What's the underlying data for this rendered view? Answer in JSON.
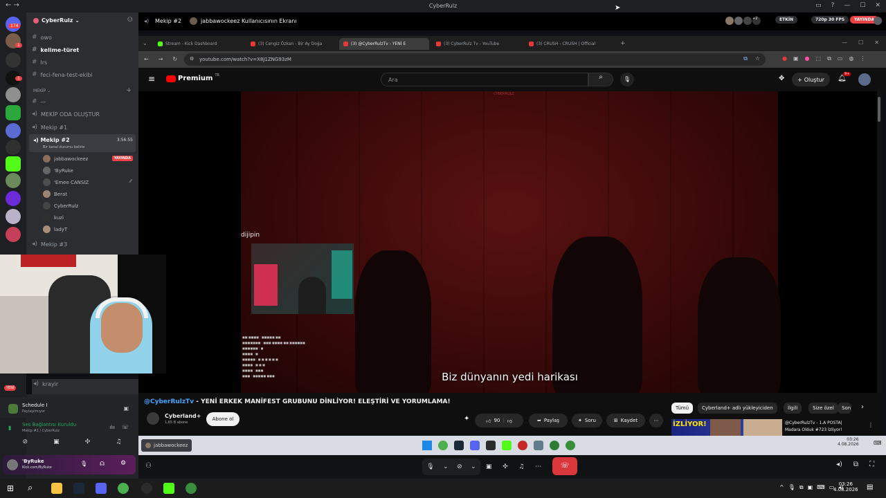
{
  "window": {
    "title": "CyberRulz"
  },
  "titlebar_nav": "← →",
  "rail_badges": {
    "top": "174",
    "notif1": "1",
    "notif2": "1"
  },
  "server": {
    "name": "CyberRulz ⌄"
  },
  "channels_top": [
    "owo",
    "kelime-türet",
    "lrs",
    "feci-fena-test-ekibi"
  ],
  "category": "MEKİP ⌄",
  "channels_mekip": [
    "—",
    "MEKİP ODA OLUŞTUR",
    "Mekip #1"
  ],
  "active_channel": {
    "name": "Mekip #2",
    "time": "3:56:55",
    "status": "Bir kanal durumu belirle"
  },
  "voice_users": [
    {
      "name": "jabbawockeez",
      "live": "YAYINDA"
    },
    {
      "name": "'ByRuke"
    },
    {
      "name": "'Emee CANSIZ"
    },
    {
      "name": "Berat"
    },
    {
      "name": "CyberRulz"
    },
    {
      "name": "kuzi"
    },
    {
      "name": "ladyT"
    }
  ],
  "channel_after": "Mekip #3",
  "channel_krayir": "krayir",
  "new_badge": "YENİ",
  "activity": {
    "title": "Schedule I",
    "sub": "Paylaşılmıyor"
  },
  "voice_conn": {
    "title": "Ses Bağlantısı Kuruldu",
    "sub": "Mekip #2 / CyberRulz"
  },
  "me": {
    "name": "'ByRuke",
    "sub": "Kick.com/ByRuke"
  },
  "stream_header": {
    "channel": "Mekip #2",
    "title": "jabbawockeez Kullanıcısının Ekranı",
    "more": "+2",
    "etkin": "ETKİN",
    "quality": "720p 30 FPS",
    "live": "YAYINDA"
  },
  "browser_tabs": [
    {
      "label": "Stream - Kick Dashboard",
      "color": "#53fc18"
    },
    {
      "label": "(3) Cengiz Özkan - Bir Ay Doğa",
      "color": "#e53935"
    },
    {
      "label": "(3) @CyberRulzTv - YENİ E",
      "color": "#e53935"
    },
    {
      "label": "(3) CyberRulz Tv - YouTube",
      "color": "#e53935"
    },
    {
      "label": "(3) CRUSH - CRUSH | Official",
      "color": "#e53935"
    }
  ],
  "url": "youtube.com/watch?v=X8J1ZNG93zM",
  "youtube": {
    "logo": "Premium",
    "tr": "TR",
    "search_placeholder": "Ara",
    "create": "Oluştur",
    "notif": "9+"
  },
  "video": {
    "watermark": "dijipin",
    "subtitle": "Biz dünyanın yedi harikası",
    "top_mark": "CYBERRULZ"
  },
  "video_title": {
    "handle": "@CyberRulzTv",
    "text": " - YENİ ERKEK MANİFEST GRUBUNU DİNLİYOR! ELEŞTİRİ VE YORUMLAMA!"
  },
  "channel_info": {
    "name": "Cyberland+",
    "subs": "1,65 B abone",
    "subscribe": "Abone ol"
  },
  "actions": {
    "likes": "90",
    "share": "Paylaş",
    "ask": "Soru",
    "save": "Kaydet"
  },
  "chips": [
    "Tümü",
    "Cyberland+ adlı yükleyiciden",
    "İlgili",
    "Size özel",
    "Son"
  ],
  "rec": {
    "title": "@CyberRulzTv - 1.A POSTA|",
    "sub": "Madara Olduk #723 İzliyor!",
    "thumb": "İZLİYOR!"
  },
  "inner_taskbar": {
    "time": "03:26",
    "date": "4.08.2026",
    "window_label": "jabbawockeez"
  },
  "taskbar": {
    "time": "03:26",
    "date": "4.08.2026"
  },
  "colors": {
    "discord_bg": "#2b2d31",
    "accent_red": "#ed4245",
    "yt_bg": "#0f0f0f"
  }
}
